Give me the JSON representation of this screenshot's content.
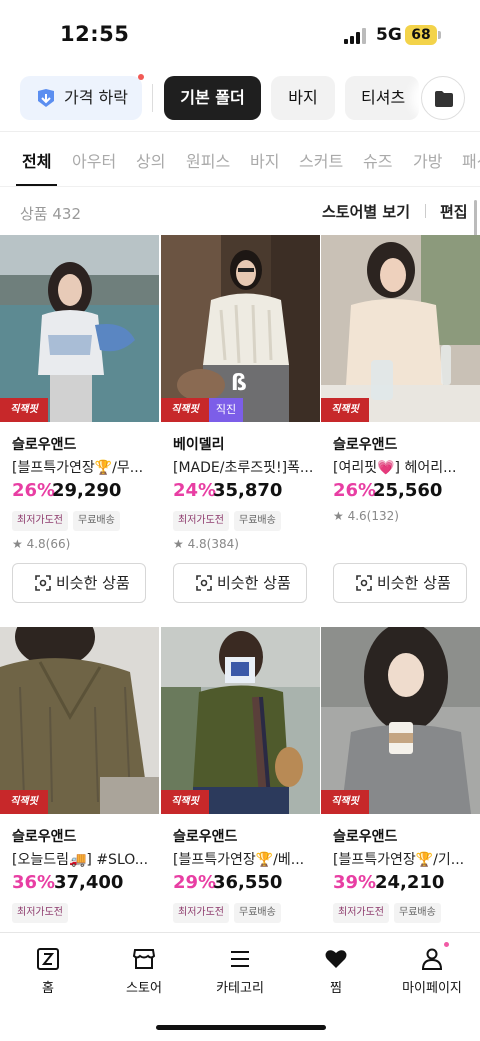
{
  "status_bar": {
    "time": "12:55",
    "network": "5G",
    "battery": "68"
  },
  "filter_chips": {
    "price_drop": "가격 하락",
    "basic_folder": "기본 폴더",
    "pants": "바지",
    "tshirts": "티셔츠"
  },
  "category_tabs": [
    "전체",
    "아우터",
    "상의",
    "원피스",
    "바지",
    "스커트",
    "슈즈",
    "가방",
    "패션"
  ],
  "list_header": {
    "count": "상품 432",
    "store_view": "스토어별 보기",
    "edit": "편집"
  },
  "badges": {
    "direct_shipping": "직잭핏",
    "direct": "직진"
  },
  "similar_button_label": "비슷한 상품",
  "tags": {
    "lowest_price": "최저가도전",
    "free_shipping": "무료배송"
  },
  "products": [
    {
      "store": "슬로우앤드",
      "title": "[블프특가연장🏆/무...",
      "discount": "26%",
      "price": "29,290",
      "tags": [
        "최저가도전",
        "무료배송"
      ],
      "rating": "4.8(66)"
    },
    {
      "store": "베이델리",
      "title": "[MADE/초루즈핏!]폭...",
      "discount": "24%",
      "price": "35,870",
      "tags": [
        "최저가도전",
        "무료배송"
      ],
      "rating": "4.8(384)"
    },
    {
      "store": "슬로우앤드",
      "title": "[여리핏💗] 헤어리...",
      "discount": "26%",
      "price": "25,560",
      "tags": [],
      "rating": "4.6(132)"
    },
    {
      "store": "슬로우앤드",
      "title": "[오늘드림🚚] #SLO...",
      "discount": "36%",
      "price": "37,400",
      "tags": [
        "최저가도전"
      ],
      "rating": ""
    },
    {
      "store": "슬로우앤드",
      "title": "[블프특가연장🏆/베...",
      "discount": "29%",
      "price": "36,550",
      "tags": [
        "최저가도전",
        "무료배송"
      ],
      "rating": ""
    },
    {
      "store": "슬로우앤드",
      "title": "[블프특가연장🏆/기...",
      "discount": "39%",
      "price": "24,210",
      "tags": [
        "최저가도전",
        "무료배송"
      ],
      "rating": ""
    }
  ],
  "bottom_nav": {
    "home": "홈",
    "store": "스토어",
    "category": "카테고리",
    "likes": "찜",
    "mypage": "마이페이지"
  },
  "colors": {
    "discount": "#e83ea3",
    "badge": "#c7282a",
    "direct": "#7c5ee8",
    "active_chip": "#1f1f1f"
  }
}
